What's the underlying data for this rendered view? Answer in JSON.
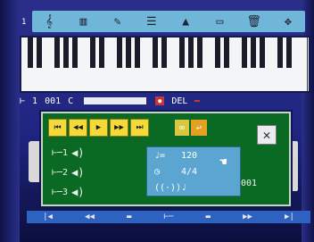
{
  "toolbar": {
    "number": "1",
    "tools": [
      {
        "icon": "treble-clef-icon",
        "glyph": "𝄞"
      },
      {
        "icon": "piano-keys-icon",
        "glyph": "▥"
      },
      {
        "icon": "note-edit-icon",
        "glyph": "✎"
      },
      {
        "icon": "staff-lines-icon",
        "glyph": "☰"
      },
      {
        "icon": "cone-icon",
        "glyph": "▲"
      },
      {
        "icon": "tape-icon",
        "glyph": "▭"
      },
      {
        "icon": "trash-can-icon",
        "glyph": "🗑"
      },
      {
        "icon": "cursor-move-icon",
        "glyph": "✥"
      }
    ]
  },
  "status": {
    "track": "1",
    "measure": "001",
    "note": "C",
    "del": "DEL"
  },
  "transport": {
    "buttons": [
      {
        "name": "skip-back-button",
        "glyph": "⏮"
      },
      {
        "name": "rewind-button",
        "glyph": "◀◀"
      },
      {
        "name": "play-button",
        "glyph": "▶"
      },
      {
        "name": "fast-forward-button",
        "glyph": "▶▶"
      },
      {
        "name": "skip-forward-button",
        "glyph": "⏭"
      }
    ]
  },
  "tracks": [
    {
      "label": "1"
    },
    {
      "label": "2"
    },
    {
      "label": "3"
    }
  ],
  "info": {
    "tempo": "120",
    "time_signature": "4/4"
  },
  "counter": "001",
  "colors": {
    "panel": "#0a6a24",
    "toolbar": "#6fb6d8",
    "transport": "#f3d93a",
    "info": "#5aa6d0",
    "background": "#1f2580"
  }
}
